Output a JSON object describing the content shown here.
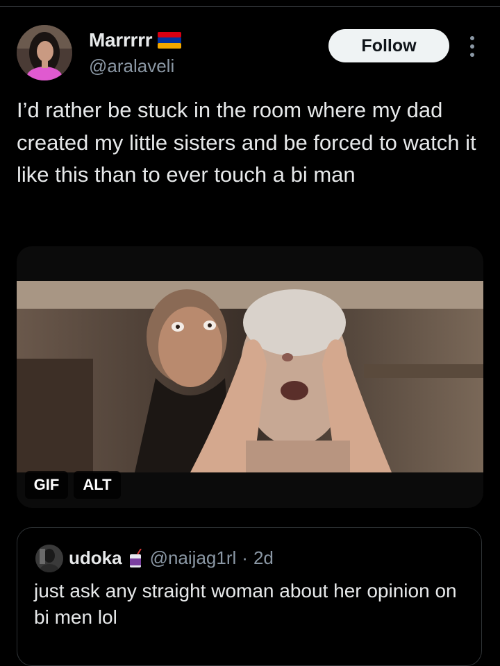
{
  "tweet": {
    "author_name": "Marrrrr",
    "author_handle": "@aralaveli",
    "follow_label": "Follow",
    "text": "I’d rather be stuck in the room where my dad created my little sisters and be forced to watch it like this than to ever touch a bi man"
  },
  "media": {
    "gif_label": "GIF",
    "alt_label": "ALT"
  },
  "quote": {
    "author_name": "udoka",
    "author_handle": "@naijag1rl",
    "separator": "·",
    "time": "2d",
    "text": "just ask any straight woman about her opinion on bi men lol"
  },
  "icons": {
    "flag": "armenia-flag-icon",
    "badge": "juice-box-emoji-icon",
    "more": "more-options-icon"
  },
  "colors": {
    "background": "#000000",
    "text_primary": "#e7e9ea",
    "text_secondary": "#8b98a5",
    "follow_bg": "#eff3f4",
    "border": "#2f3336"
  }
}
